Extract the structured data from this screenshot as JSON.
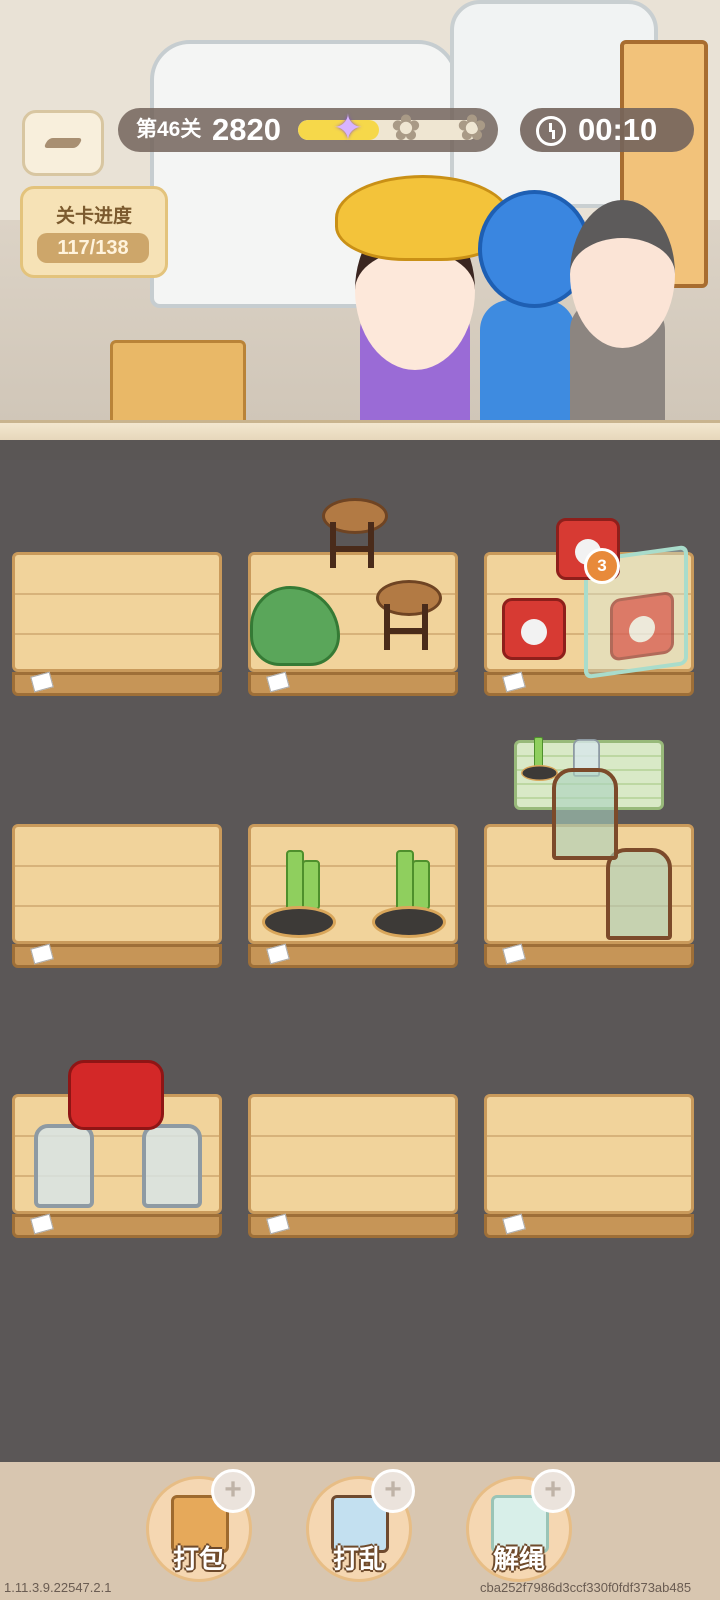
{
  "hud": {
    "level_label": "第46关",
    "score": "2820",
    "score_progress": 0.45,
    "stars_earned": 1,
    "stars_total": 3,
    "timer": "00:10",
    "progress_title": "关卡进度",
    "progress_count": "117/138"
  },
  "pallets": [
    {
      "row": 1,
      "col": 1,
      "items": []
    },
    {
      "row": 1,
      "col": 2,
      "items": [
        "dinosaur-plush",
        "wooden-stool",
        "wooden-stool"
      ]
    },
    {
      "row": 1,
      "col": 3,
      "items": [
        "red-telephone",
        "red-telephone",
        "red-telephone-in-glass-box"
      ]
    },
    {
      "row": 2,
      "col": 1,
      "items": []
    },
    {
      "row": 2,
      "col": 2,
      "items": [
        "bamboo-bonsai",
        "bamboo-bonsai"
      ]
    },
    {
      "row": 2,
      "col": 3,
      "items": [
        "terrarium",
        "terrarium"
      ]
    },
    {
      "row": 3,
      "col": 1,
      "items": [
        "red-armchair",
        "silver-lantern",
        "silver-lantern"
      ]
    },
    {
      "row": 3,
      "col": 2,
      "items": []
    },
    {
      "row": 3,
      "col": 3,
      "items": []
    }
  ],
  "locked_box_count": "3",
  "tools": [
    {
      "label": "打包",
      "icon": "package-box-icon"
    },
    {
      "label": "打乱",
      "icon": "shuffle-items-icon"
    },
    {
      "label": "解绳",
      "icon": "untie-rope-icon"
    }
  ],
  "footer": {
    "version": "1.11.3.9.22547.2.1",
    "build_hash": "cba252f7986d3ccf330f0fdf373ab485"
  },
  "colors": {
    "board_bg": "#5b5757",
    "wood": "#f1d39b",
    "hud_bg": "#73645c",
    "accent_yellow": "#f6d84a"
  }
}
